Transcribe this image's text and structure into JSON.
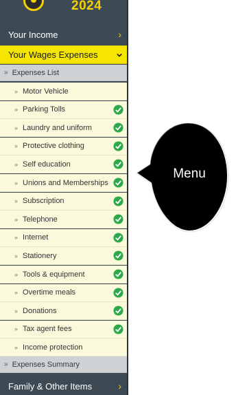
{
  "header": {
    "year": "2024"
  },
  "nav": {
    "income": "Your Income",
    "wages": "Your Wages Expenses",
    "expenses_list": "Expenses List",
    "expenses_summary": "Expenses Summary",
    "family": "Family & Other Items"
  },
  "items": [
    {
      "label": "Motor Vehicle",
      "checked": false
    },
    {
      "label": "Parking Tolls",
      "checked": true
    },
    {
      "label": "Laundry and uniform",
      "checked": true
    },
    {
      "label": "Protective clothing",
      "checked": true
    },
    {
      "label": "Self education",
      "checked": true
    },
    {
      "label": "Unions and Memberships",
      "checked": true
    },
    {
      "label": "Subscription",
      "checked": true
    },
    {
      "label": "Telephone",
      "checked": true
    },
    {
      "label": "Internet",
      "checked": true
    },
    {
      "label": "Stationery",
      "checked": true
    },
    {
      "label": "Tools & equipment",
      "checked": true
    },
    {
      "label": "Overtime meals",
      "checked": true
    },
    {
      "label": "Donations",
      "checked": true
    },
    {
      "label": "Tax agent fees",
      "checked": true
    },
    {
      "label": "Income protection",
      "checked": false
    }
  ],
  "callout": {
    "text": "Menu"
  },
  "colors": {
    "sidebar": "#3d4a54",
    "accent": "#f5e500",
    "check": "#2ea84a",
    "item_bg": "#fbf9dc"
  }
}
